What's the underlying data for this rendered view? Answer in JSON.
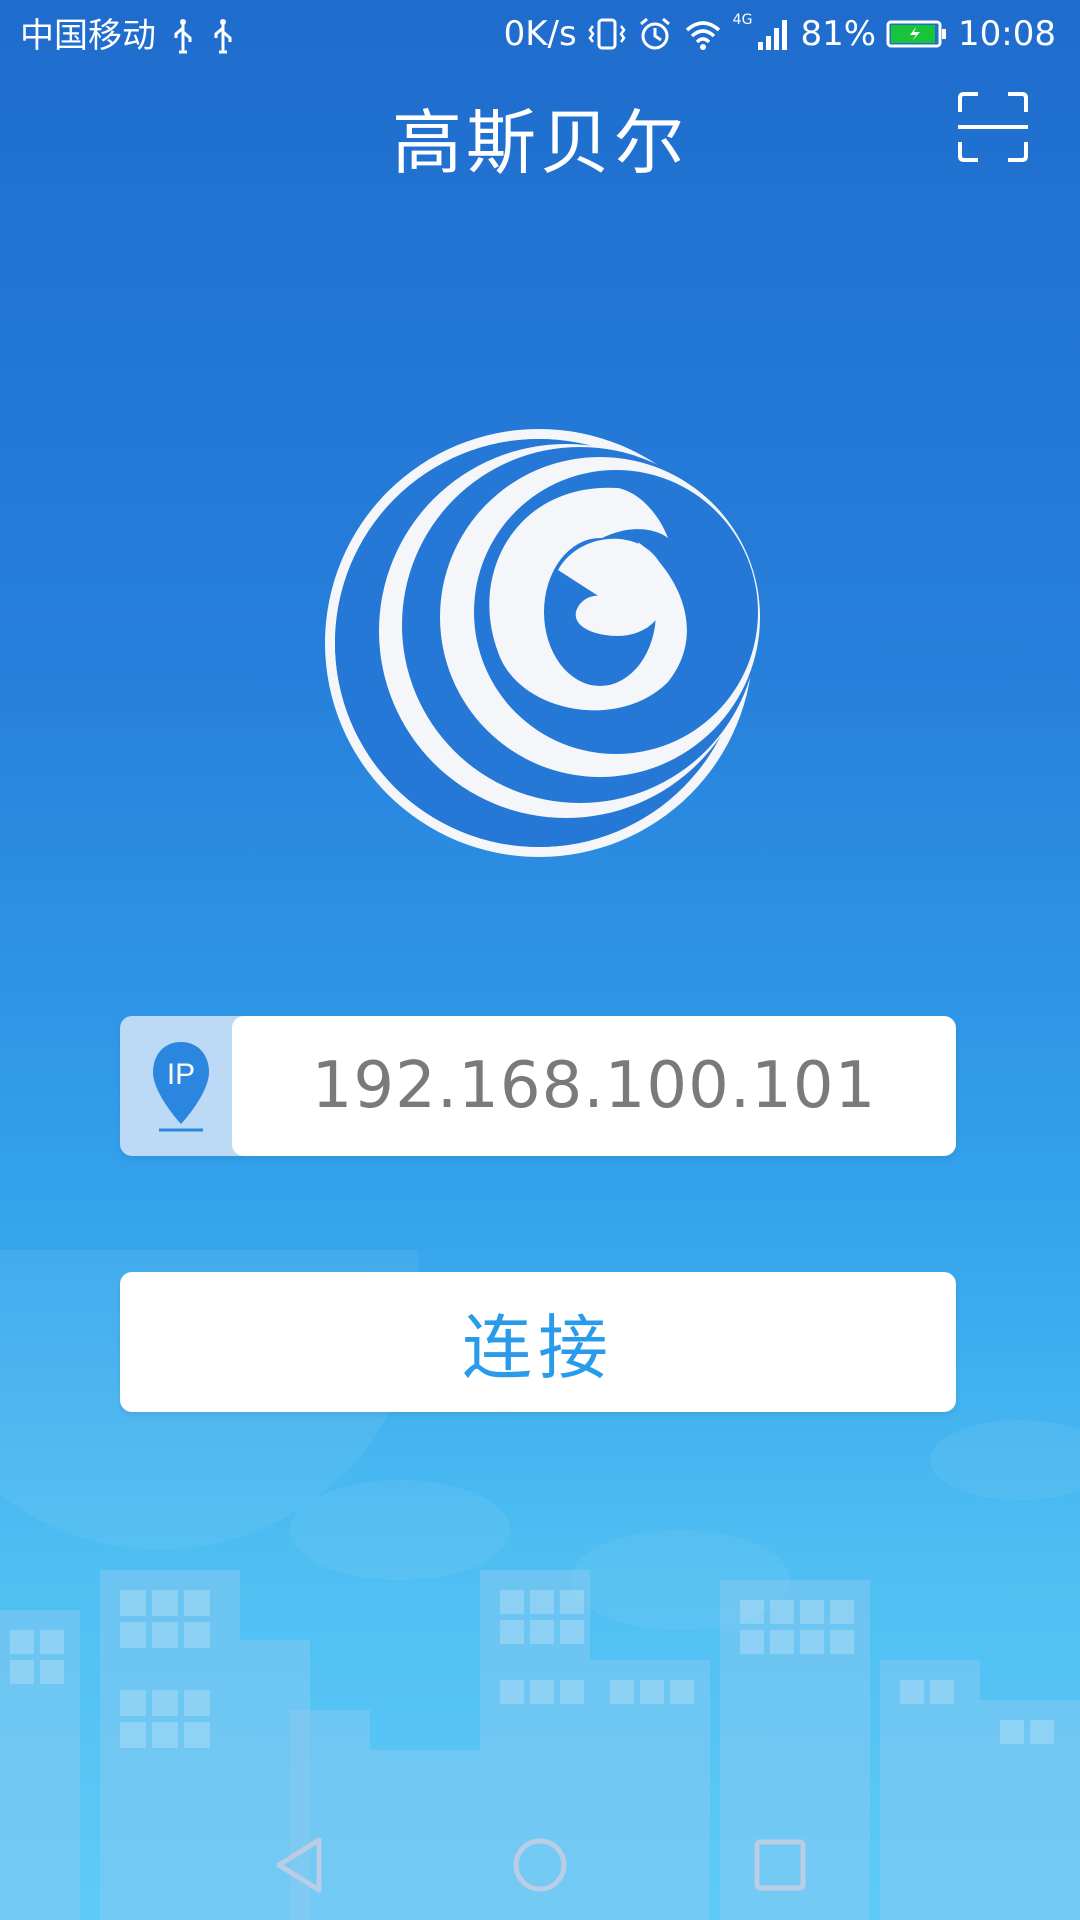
{
  "status_bar": {
    "carrier": "中国移动",
    "speed": "0K/s",
    "network": "4G",
    "battery": "81%",
    "time": "10:08"
  },
  "header": {
    "title": "高斯贝尔",
    "scan_icon": "scan-frame-icon"
  },
  "logo": {
    "icon": "brand-logo-icon"
  },
  "ip_input": {
    "badge_label": "IP",
    "badge_icon": "location-pin-icon",
    "value": "192.168.100.101"
  },
  "connect_button": {
    "label": "连接"
  },
  "nav": {
    "back_icon": "back-triangle-icon",
    "home_icon": "home-circle-icon",
    "recents_icon": "recents-square-icon"
  },
  "colors": {
    "background_top": "#1f6ccd",
    "background_bottom": "#5ecbf7",
    "accent": "#2a9bea",
    "input_text": "#7a7a7a",
    "battery_green": "#19c43a"
  }
}
